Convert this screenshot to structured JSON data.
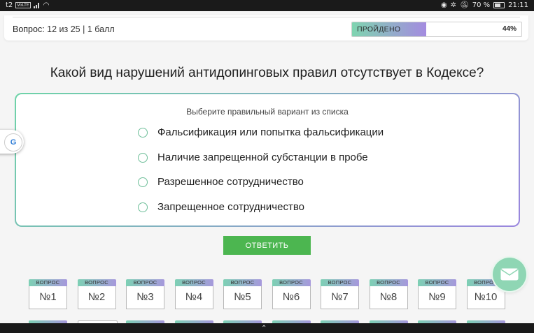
{
  "status_bar": {
    "carrier": "t2",
    "volte": "VoLTE",
    "battery": "70 %",
    "time": "21:11"
  },
  "header": {
    "question_label": "Вопрос:",
    "question_progress": "12 из 25 | 1 балл",
    "progress_label": "ПРОЙДЕНО",
    "progress_percent_text": "44%",
    "progress_value": 0.44
  },
  "question": {
    "text": "Какой вид нарушений антидопинговых правил отсутствует в Кодексе?"
  },
  "answers": {
    "hint": "Выберите правильный вариант из списка",
    "options": [
      "Фальсификация или попытка фальсификации",
      "Наличие запрещенной субстанции в пробе",
      "Разрешенное сотрудничество",
      "Запрещенное сотрудничество"
    ]
  },
  "submit": {
    "label": "ОТВЕТИТЬ"
  },
  "question_nav": {
    "caption": "ВОПРОС",
    "items": [
      "№1",
      "№2",
      "№3",
      "№4",
      "№5",
      "№6",
      "№7",
      "№8",
      "№9",
      "№10"
    ]
  },
  "icons": {
    "side_widget": "translate-icon",
    "mail": "mail-icon",
    "nav": "chevron-up-icon"
  },
  "colors": {
    "accent_green": "#4cb650",
    "gradient_start": "#7fd4b0",
    "gradient_end": "#a48be0"
  }
}
